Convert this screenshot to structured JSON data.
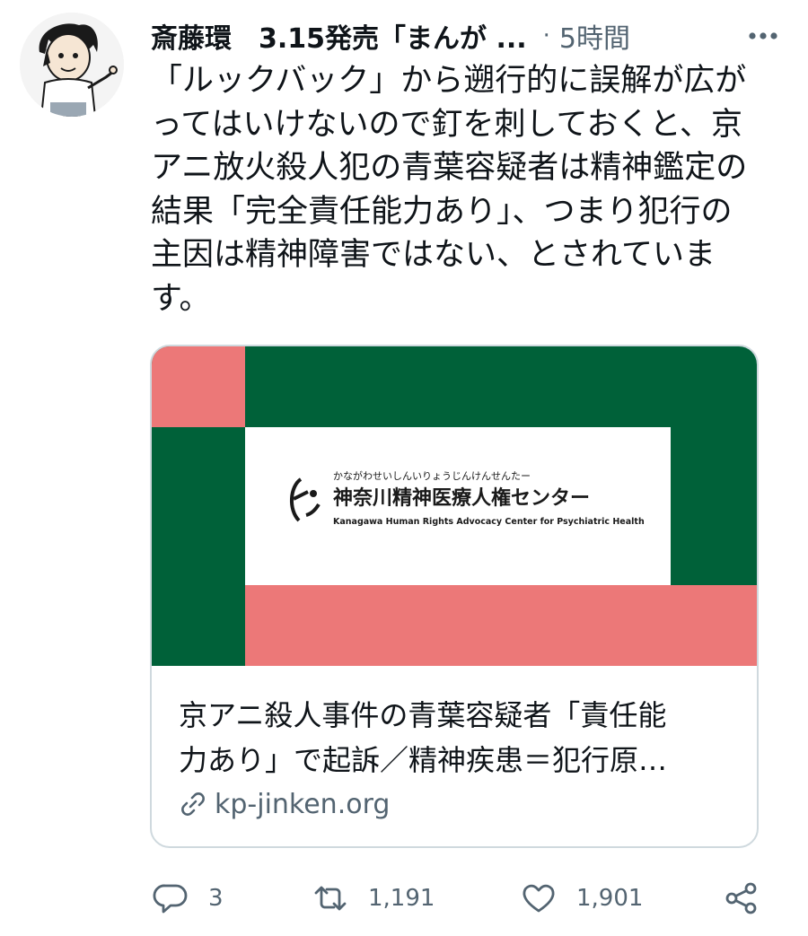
{
  "tweet": {
    "author": "斎藤環　3.15発売「まんが ...",
    "separator": "·",
    "time": "5時間",
    "text_lines": [
      "「ルックバック」から遡行的に誤解が広が",
      "ってはいけないので釘を刺しておくと、京",
      "アニ放火殺人犯の青葉容疑者は精神鑑定の",
      "結果「完全責任能力あり」、つまり犯行の",
      "主因は精神障害ではない、とされていま",
      "す。"
    ]
  },
  "card": {
    "logo": {
      "furigana": "かながわせいしんいりょうじんけんせんたー",
      "name_ja": "神奈川精神医療人権センター",
      "name_en": "Kanagawa Human Rights Advocacy Center for Psychiatric Health"
    },
    "title_lines": [
      "京アニ殺人事件の青葉容疑者「責任能",
      "力あり」で起訴／精神疾患＝犯行原…"
    ],
    "domain": "kp-jinken.org",
    "colors": {
      "green": "#006139",
      "pink": "#ec7878"
    }
  },
  "actions": {
    "reply_count": "3",
    "retweet_count": "1,191",
    "like_count": "1,901"
  },
  "icons": {
    "avatar": "cartoon-man-avatar",
    "more": "more-dots-icon",
    "link": "link-icon",
    "reply": "reply-icon",
    "retweet": "retweet-icon",
    "like": "heart-icon",
    "share": "share-icon"
  }
}
